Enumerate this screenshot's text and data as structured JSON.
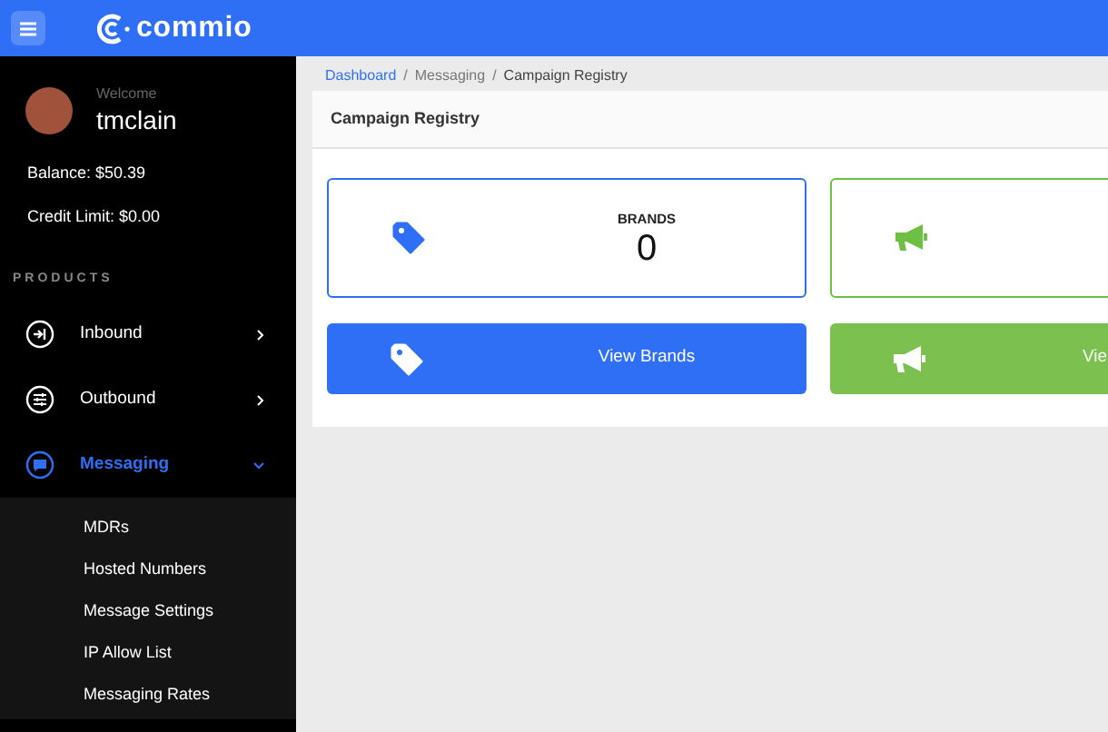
{
  "header": {
    "logo": "commio"
  },
  "user": {
    "welcome": "Welcome",
    "name": "tmclain",
    "balance": "Balance: $50.39",
    "credit_limit": "Credit Limit: $0.00"
  },
  "sidebar": {
    "section": "PRODUCTS",
    "items": [
      {
        "label": "Inbound",
        "kind": "inbound",
        "expanded": false,
        "selected": false
      },
      {
        "label": "Outbound",
        "kind": "outbound",
        "expanded": false,
        "selected": false
      },
      {
        "label": "Messaging",
        "kind": "messaging",
        "expanded": true,
        "selected": true,
        "children": [
          {
            "label": "MDRs"
          },
          {
            "label": "Hosted Numbers"
          },
          {
            "label": "Message Settings"
          },
          {
            "label": "IP Allow List"
          },
          {
            "label": "Messaging Rates"
          }
        ]
      }
    ]
  },
  "breadcrumb": [
    {
      "label": "Dashboard",
      "link": true
    },
    {
      "separator": "/",
      "label": "Messaging",
      "link": false
    },
    {
      "separator": "/",
      "label": "Campaign Registry",
      "link": false
    }
  ],
  "card": {
    "title": "Campaign Registry",
    "stats": [
      {
        "kind": "brands",
        "label": "BRANDS",
        "value": "0",
        "color": "#2e6ff5"
      },
      {
        "kind": "campaigns",
        "color": "#6fbf44"
      }
    ],
    "buttons": [
      {
        "kind": "brands",
        "label": "View Brands",
        "color": "#2e6ff5"
      },
      {
        "kind": "campaigns",
        "label": "Vie",
        "color": "#7cc04f"
      }
    ]
  }
}
